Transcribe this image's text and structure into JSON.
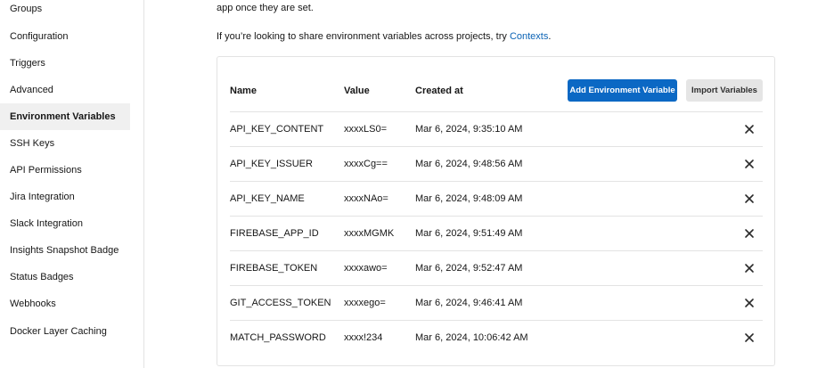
{
  "sidebar": {
    "items": [
      {
        "label": "Groups"
      },
      {
        "label": "Configuration"
      },
      {
        "label": "Triggers"
      },
      {
        "label": "Advanced"
      },
      {
        "label": "Environment Variables",
        "active": true
      },
      {
        "label": "SSH Keys"
      },
      {
        "label": "API Permissions"
      },
      {
        "label": "Jira Integration"
      },
      {
        "label": "Slack Integration"
      },
      {
        "label": "Insights Snapshot Badge"
      },
      {
        "label": "Status Badges"
      },
      {
        "label": "Webhooks"
      },
      {
        "label": "Docker Layer Caching"
      }
    ]
  },
  "main": {
    "intro_line1": "app once they are set.",
    "intro_line2_prefix": "If you’re looking to share environment variables across projects, try ",
    "intro_link": "Contexts",
    "intro_line2_suffix": "."
  },
  "table": {
    "headers": {
      "name": "Name",
      "value": "Value",
      "created": "Created at"
    },
    "add_button": "Add Environment Variable",
    "import_button": "Import Variables",
    "rows": [
      {
        "name": "API_KEY_CONTENT",
        "value": "xxxxLS0=",
        "created": "Mar 6, 2024, 9:35:10 AM"
      },
      {
        "name": "API_KEY_ISSUER",
        "value": "xxxxCg==",
        "created": "Mar 6, 2024, 9:48:56 AM"
      },
      {
        "name": "API_KEY_NAME",
        "value": "xxxxNAo=",
        "created": "Mar 6, 2024, 9:48:09 AM"
      },
      {
        "name": "FIREBASE_APP_ID",
        "value": "xxxxMGMK",
        "created": "Mar 6, 2024, 9:51:49 AM"
      },
      {
        "name": "FIREBASE_TOKEN",
        "value": "xxxxawo=",
        "created": "Mar 6, 2024, 9:52:47 AM"
      },
      {
        "name": "GIT_ACCESS_TOKEN",
        "value": "xxxxego=",
        "created": "Mar 6, 2024, 9:46:41 AM"
      },
      {
        "name": "MATCH_PASSWORD",
        "value": "xxxx!234",
        "created": "Mar 6, 2024, 10:06:42 AM"
      }
    ]
  },
  "colors": {
    "accent": "#0b68c4",
    "link": "#0b63b5",
    "active_bg": "#f0f0f0"
  },
  "icons": {
    "delete": "close-icon"
  }
}
